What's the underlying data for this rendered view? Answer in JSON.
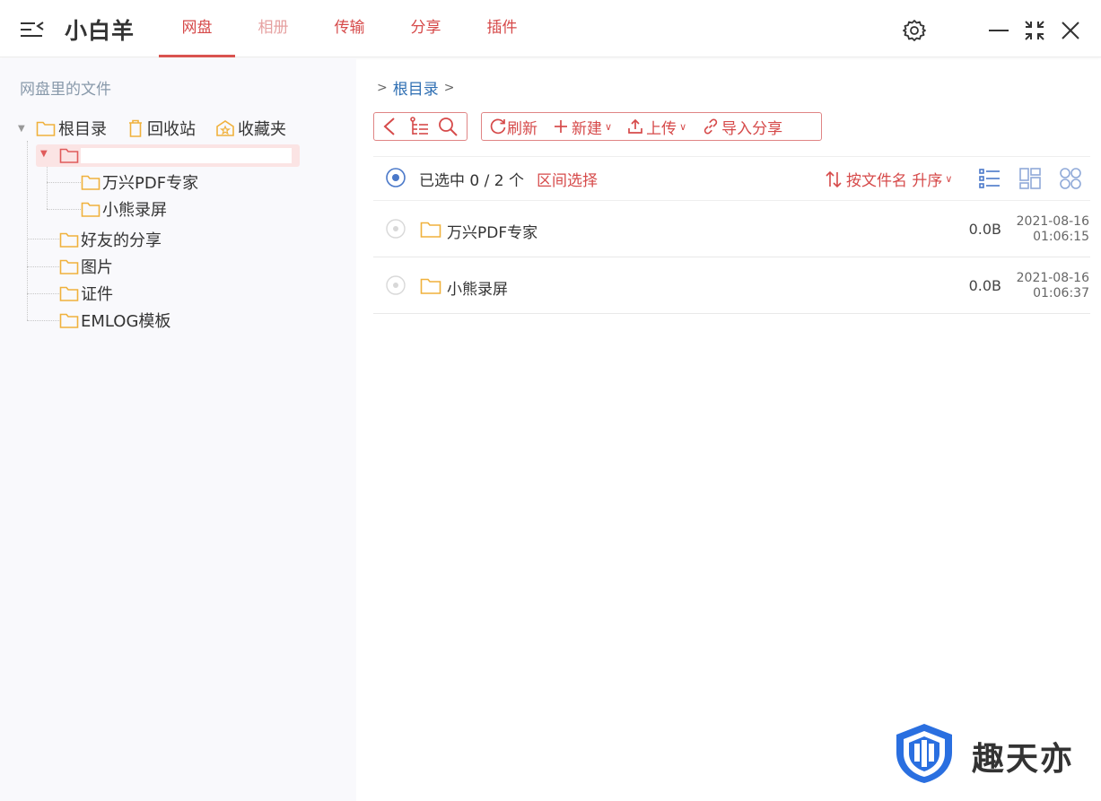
{
  "header": {
    "app_title": "小白羊",
    "tabs": [
      {
        "label": "网盘"
      },
      {
        "label": "相册"
      },
      {
        "label": "传输"
      },
      {
        "label": "分享"
      },
      {
        "label": "插件"
      }
    ]
  },
  "sidebar": {
    "title": "网盘里的文件",
    "top_nodes": [
      {
        "label": "根目录"
      },
      {
        "label": "回收站"
      },
      {
        "label": "收藏夹"
      }
    ],
    "tree": {
      "sub_children": [
        {
          "label": "万兴PDF专家"
        },
        {
          "label": "小熊录屏"
        }
      ],
      "children": [
        {
          "label": "好友的分享"
        },
        {
          "label": "图片"
        },
        {
          "label": "证件"
        },
        {
          "label": "EMLOG模板"
        }
      ]
    }
  },
  "main": {
    "breadcrumb": {
      "prefix": ">",
      "root": "根目录",
      "suffix": ">"
    },
    "toolbar": {
      "refresh": "刷新",
      "new": "新建",
      "upload": "上传",
      "import_share": "导入分享"
    },
    "selection": {
      "text": "已选中 0 / 2 个",
      "range_select": "区间选择",
      "sort": "按文件名 升序"
    },
    "files": [
      {
        "name": "万兴PDF专家",
        "size": "0.0B",
        "date": "2021-08-16",
        "time": "01:06:15"
      },
      {
        "name": "小熊录屏",
        "size": "0.0B",
        "date": "2021-08-16",
        "time": "01:06:37"
      }
    ]
  },
  "watermark": {
    "text": "趣天亦"
  },
  "colors": {
    "accent": "#d64a4a",
    "link": "#2f6fb3",
    "folder": "#f0b13c",
    "selection_bg": "#fbe4e4"
  }
}
